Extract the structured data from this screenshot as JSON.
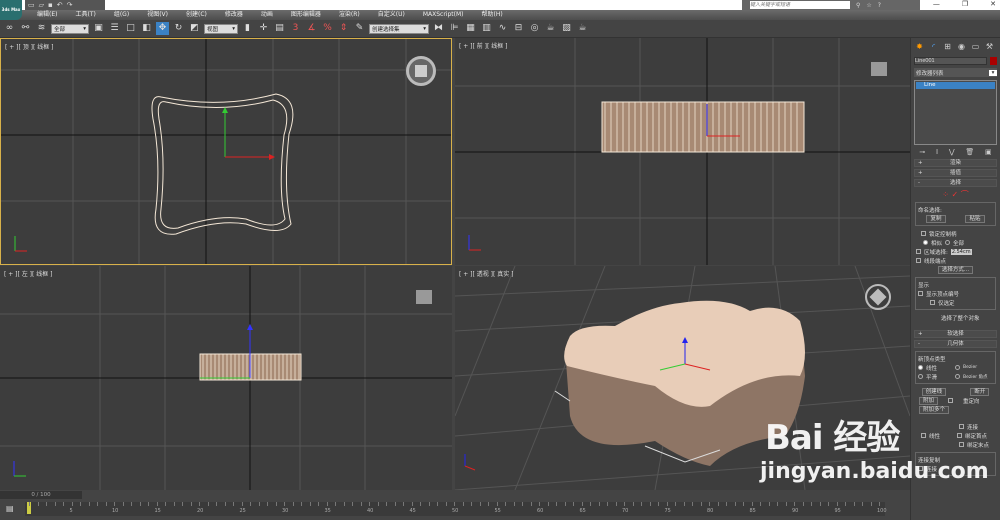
{
  "title_bar": {
    "logo": "3ds Max",
    "search_placeholder": "键入关键字或短语",
    "window_controls": [
      "—",
      "❐",
      "✕"
    ],
    "quick_access": [
      "new",
      "open",
      "save",
      "undo",
      "redo"
    ]
  },
  "menu": [
    "编辑(E)",
    "工具(T)",
    "组(G)",
    "视图(V)",
    "创建(C)",
    "修改器",
    "动画",
    "图形编辑器",
    "渲染(R)",
    "自定义(U)",
    "MAXScript(M)",
    "帮助(H)"
  ],
  "toolbar": {
    "selection_filter": "全部",
    "reference_coord": "视图",
    "named_selection": "创建选择集",
    "snap_labels": [
      "3",
      "%"
    ]
  },
  "viewports": [
    {
      "label": "[ + ][ 顶 ][ 线框 ]",
      "active": true
    },
    {
      "label": "[ + ][ 前 ][ 线框 ]"
    },
    {
      "label": "[ + ][ 左 ][ 线框 ]"
    },
    {
      "label": "[ + ][ 透视 ][ 真实 ]"
    }
  ],
  "command_panel": {
    "object_name": "Line001",
    "object_color": "#a00000",
    "modifier_list": "修改器列表",
    "stack": [
      "Line"
    ],
    "rollouts": {
      "rendering": "渲染",
      "interpolation": "插值",
      "selection": "选择",
      "soft_selection": "软选择",
      "geometry": "几何体"
    },
    "selection": {
      "named_sel": "命名选择:",
      "copy": "复制",
      "paste": "粘贴",
      "lock_handles": "锁定控制柄",
      "similar": "相似",
      "all": "全部",
      "area_select": "区域选择:",
      "area_value": "2.54cm",
      "segment_end": "线段端点",
      "select_by": "选择方式...",
      "display": "显示",
      "show_vertex_numbers": "显示顶点编号",
      "selected_only": "仅选定",
      "status": "选择了整个对象"
    },
    "geometry": {
      "new_vertex_type": "新顶点类型",
      "linear": "线性",
      "bezier": "Bezier",
      "smooth": "平滑",
      "bezier_corner": "Bezier 角点",
      "create_line": "创建线",
      "break": "断开",
      "attach": "附加",
      "reorient": "重定向",
      "attach_multiple": "附加多个",
      "connect": "连接",
      "linear2": "线性",
      "bind_first": "绑定首点",
      "bind_last": "绑定末点",
      "connect_copy": "连接复制",
      "connect2": "连接"
    }
  },
  "timeline": {
    "frame": "0 / 100",
    "ticks": [
      "0",
      "5",
      "10",
      "15",
      "20",
      "25",
      "30",
      "35",
      "40",
      "45",
      "50",
      "55",
      "60",
      "65",
      "70",
      "75",
      "80",
      "85",
      "90",
      "95",
      "100"
    ]
  },
  "watermark": {
    "brand": "Bai 经验",
    "url": "jingyan.baidu.com"
  }
}
